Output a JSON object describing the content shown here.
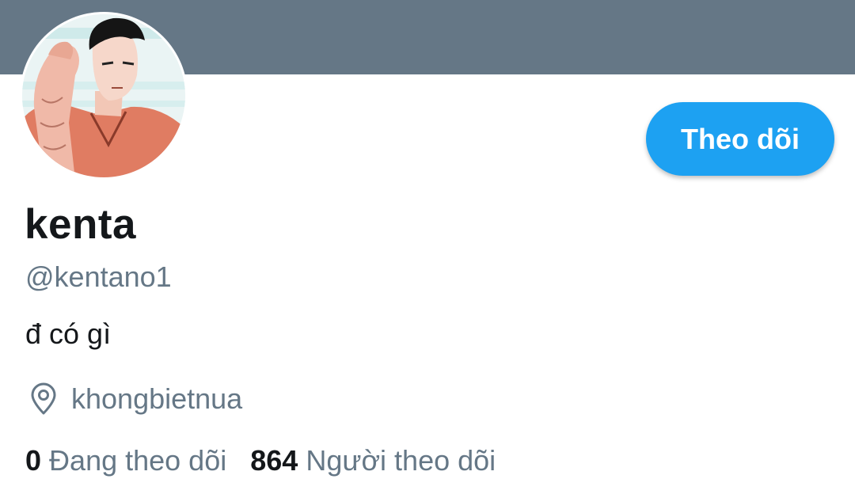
{
  "profile": {
    "name": "kenta",
    "handle": "@kentano1",
    "bio": "đ có gì",
    "location": "khongbietnua",
    "follow_label": "Theo dõi",
    "avatar_icon": "avatar-illustration"
  },
  "stats": {
    "following_count": "0",
    "following_label": "Đang theo dõi",
    "followers_count": "864",
    "followers_label": "Người theo dõi"
  },
  "colors": {
    "banner": "#657786",
    "accent": "#1da1f2",
    "text_primary": "#14171a",
    "text_secondary": "#657786"
  }
}
